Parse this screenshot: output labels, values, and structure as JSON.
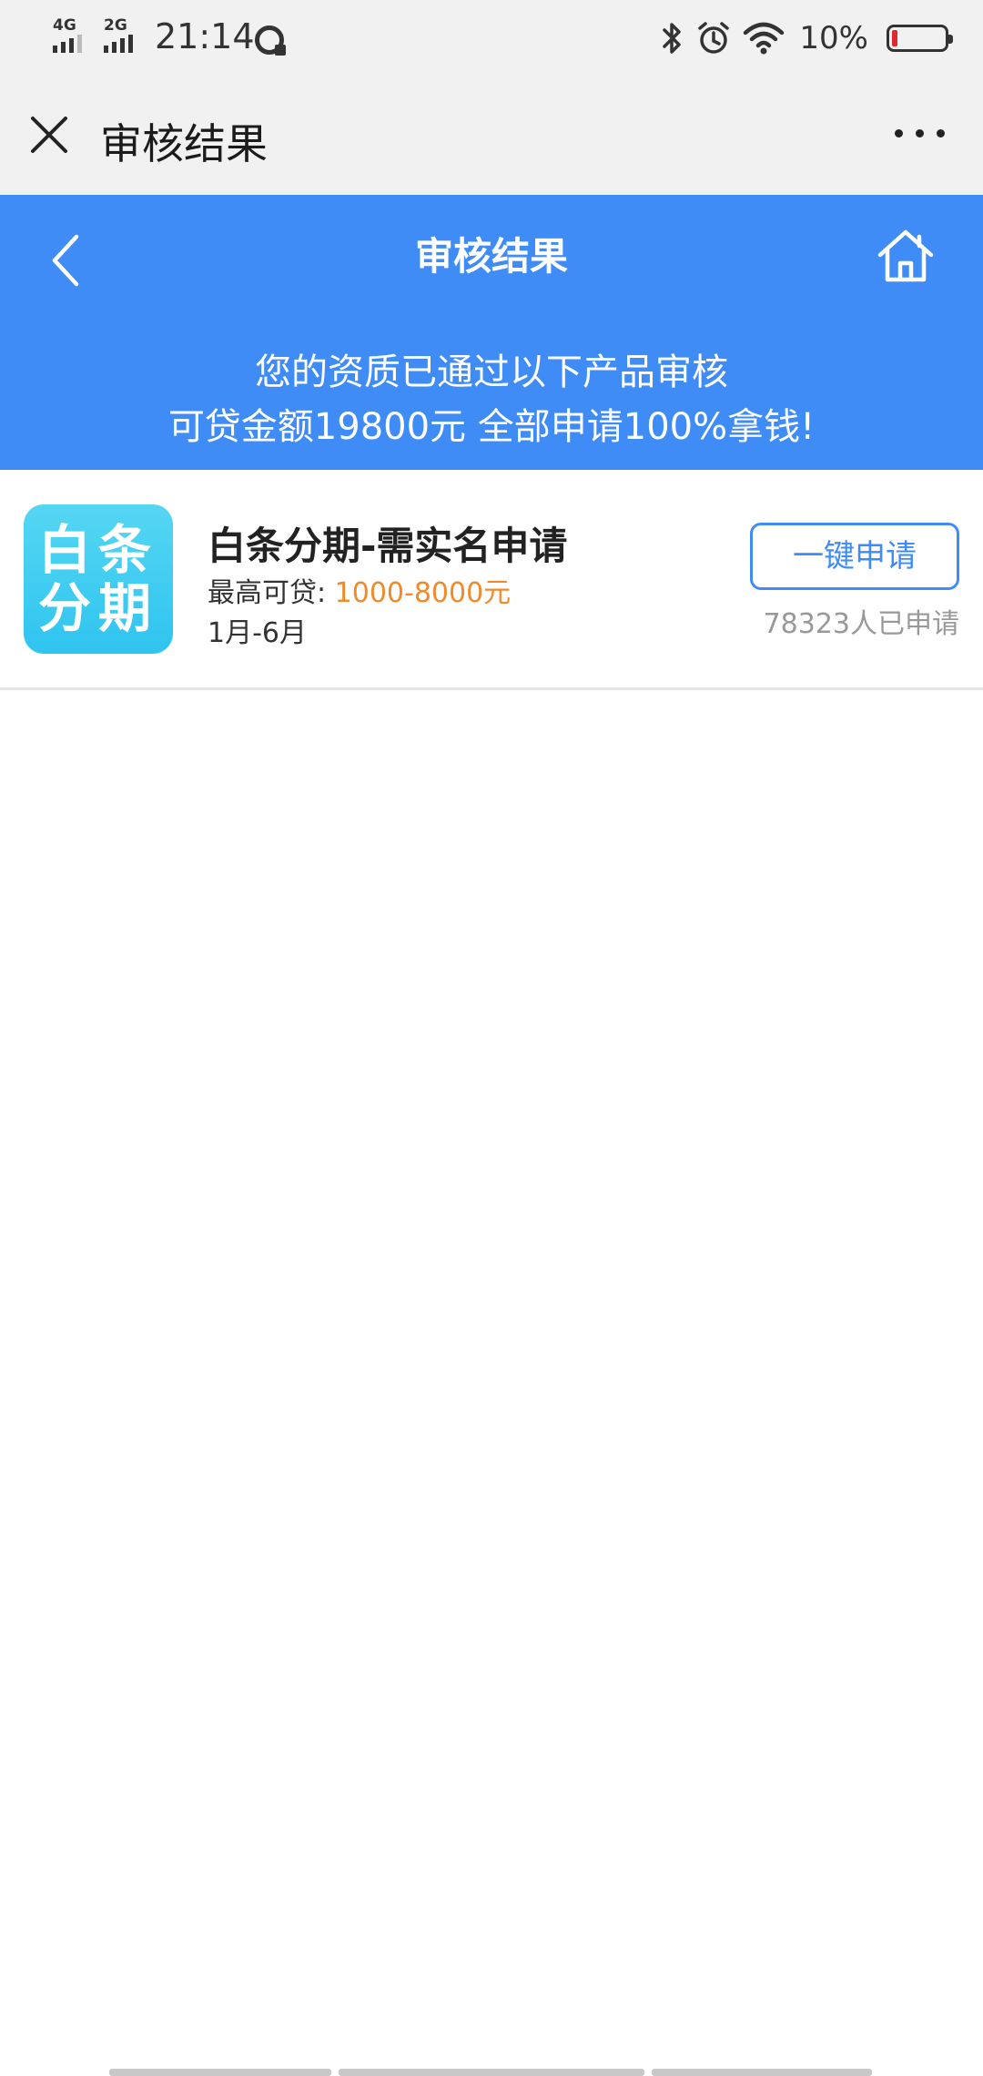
{
  "status_bar": {
    "net1": "4G",
    "net2": "2G",
    "time": "21:14",
    "battery_percent": "10%",
    "battery_level": 0.1,
    "icons": [
      "signal-icon",
      "moments-icon",
      "bluetooth-icon",
      "alarm-icon",
      "wifi-icon",
      "battery-icon"
    ]
  },
  "titlebar": {
    "title": "审核结果",
    "close_icon": "close-icon",
    "more_icon": "more-icon"
  },
  "header": {
    "title": "审核结果",
    "line1": "您的资质已通过以下产品审核",
    "line2": "可贷金额19800元 全部申请100%拿钱!",
    "back_icon": "chevron-left-icon",
    "home_icon": "home-icon",
    "color": "#3f8cf7"
  },
  "product": {
    "logo_line1": "白条",
    "logo_line2": "分期",
    "title": "白条分期-需实名申请",
    "amount_label": "最高可贷:",
    "amount_value": "1000-8000元",
    "term": "1月-6月",
    "button": "一键申请",
    "applicants": "78323人已申请",
    "accent_color": "#f08a2c"
  }
}
